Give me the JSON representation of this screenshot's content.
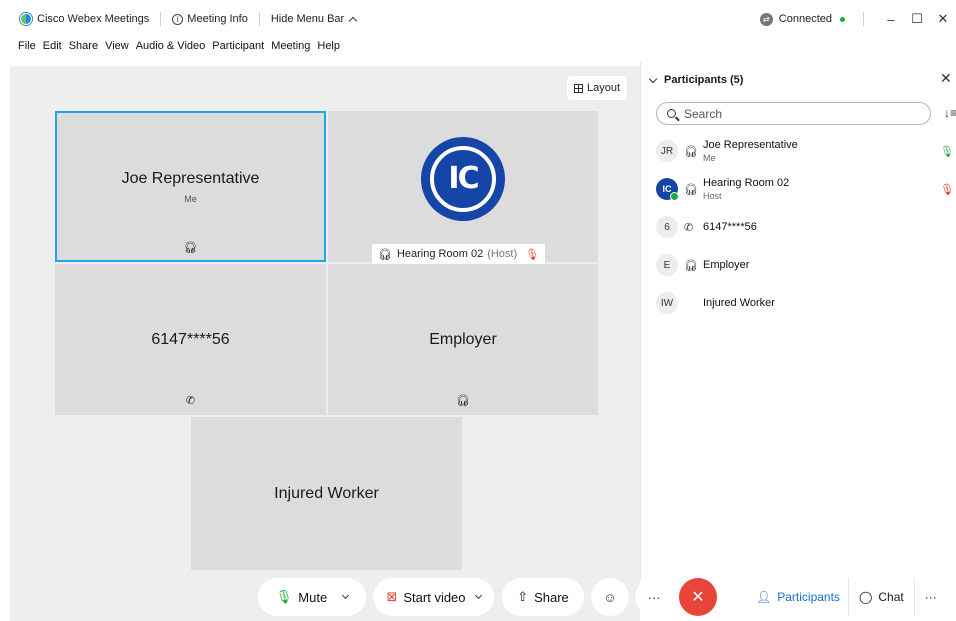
{
  "titlebar": {
    "app_name": "Cisco Webex Meetings",
    "meeting_info": "Meeting Info",
    "hide_menu": "Hide Menu Bar",
    "status": "Connected",
    "min": "–",
    "max": "☐",
    "close": "✕"
  },
  "menubar": [
    "File",
    "Edit",
    "Share",
    "View",
    "Audio & Video",
    "Participant",
    "Meeting",
    "Help"
  ],
  "stage": {
    "layout_label": "Layout",
    "tiles": {
      "joe": {
        "name": "Joe Representative",
        "sub": "Me"
      },
      "hearing": {
        "initials": "IC",
        "tag_name": "Hearing Room 02",
        "tag_role": "(Host)"
      },
      "phone": {
        "name": "6147****56"
      },
      "employer": {
        "name": "Employer"
      },
      "injured": {
        "name": "Injured Worker"
      }
    }
  },
  "panel": {
    "title": "Participants (5)",
    "close": "✕",
    "search_placeholder": "Search",
    "participants": [
      {
        "initials": "JR",
        "name": "Joe Representative",
        "sub": "Me",
        "status": "mic-on"
      },
      {
        "initials": "IC",
        "name": "Hearing Room 02",
        "sub": "Host",
        "status": "mic-muted"
      },
      {
        "initials": "6",
        "name": "6147****56",
        "sub": "",
        "status": ""
      },
      {
        "initials": "E",
        "name": "Employer",
        "sub": "",
        "status": ""
      },
      {
        "initials": "IW",
        "name": "Injured Worker",
        "sub": "",
        "status": ""
      }
    ]
  },
  "toolbar": {
    "mute": "Mute",
    "start_video": "Start video",
    "share": "Share",
    "participants": "Participants",
    "chat": "Chat",
    "more": "···"
  },
  "colors": {
    "accent": "#22a6e8",
    "end_call": "#e8443a",
    "host_blue": "#1645a8",
    "connected": "#1eaa3a"
  }
}
